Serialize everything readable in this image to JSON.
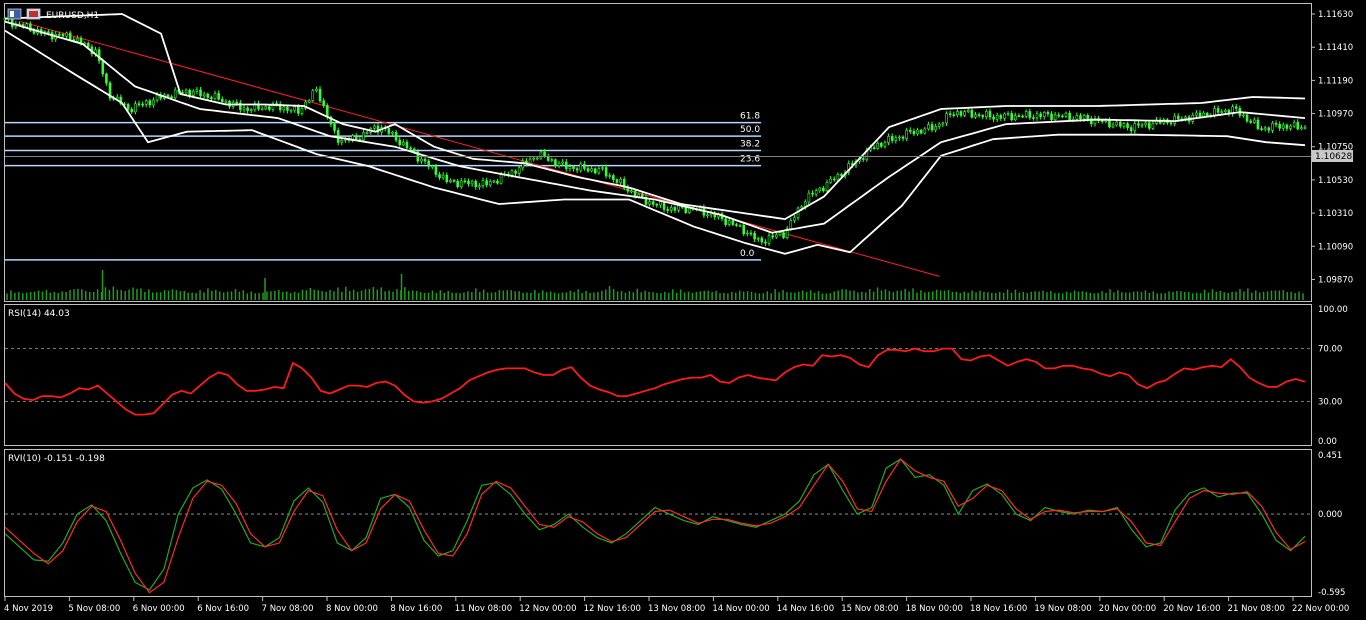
{
  "symbol_title": "EURUSD,H1",
  "colors": {
    "background": "#000000",
    "panel_border": "#c0c0c0",
    "candle": "#33ff33",
    "bands": "#ffffff",
    "fib": "#b4d7ff",
    "trend": "#ff2020",
    "volume": "#1f9d1f",
    "rsi": "#ff1a1a",
    "rvi_main": "#1faa1f",
    "rvi_signal": "#ff2a2a",
    "current_price_box": "#c8c8c8"
  },
  "current_price_label": "1.10628",
  "rsi_header": "RSI(14) 44.03",
  "rvi_header": "RVI(10) -0.151 -0.198",
  "chart_data": [
    {
      "type": "candlestick",
      "title": "EURUSD,H1",
      "price_ticks": [
        "1.11630",
        "1.11410",
        "1.11190",
        "1.10970",
        "1.10750",
        "1.10530",
        "1.10310",
        "1.10090",
        "1.09870"
      ],
      "ylim": [
        1.098,
        1.1167
      ],
      "current_price": 1.10628,
      "fibonacci_levels": [
        {
          "label": "61.8",
          "price": 1.1091
        },
        {
          "label": "50.0",
          "price": 1.1082
        },
        {
          "label": "38.2",
          "price": 1.10725
        },
        {
          "label": "23.6",
          "price": 1.10625
        },
        {
          "label": "0.0",
          "price": 1.1
        }
      ],
      "price_path_anchors": [
        [
          0,
          1.1159
        ],
        [
          0.03,
          1.115
        ],
        [
          0.05,
          1.1148
        ],
        [
          0.07,
          1.1138
        ],
        [
          0.08,
          1.111
        ],
        [
          0.095,
          1.11
        ],
        [
          0.12,
          1.1108
        ],
        [
          0.14,
          1.1112
        ],
        [
          0.16,
          1.1108
        ],
        [
          0.185,
          1.11
        ],
        [
          0.21,
          1.1102
        ],
        [
          0.225,
          1.1098
        ],
        [
          0.24,
          1.1113
        ],
        [
          0.255,
          1.108
        ],
        [
          0.27,
          1.108
        ],
        [
          0.28,
          1.1086
        ],
        [
          0.29,
          1.1088
        ],
        [
          0.31,
          1.1074
        ],
        [
          0.34,
          1.1052
        ],
        [
          0.37,
          1.105
        ],
        [
          0.39,
          1.1058
        ],
        [
          0.41,
          1.107
        ],
        [
          0.43,
          1.1062
        ],
        [
          0.46,
          1.1059
        ],
        [
          0.49,
          1.104
        ],
        [
          0.51,
          1.1034
        ],
        [
          0.53,
          1.1034
        ],
        [
          0.55,
          1.1028
        ],
        [
          0.57,
          1.1019
        ],
        [
          0.58,
          1.1012
        ],
        [
          0.6,
          1.1018
        ],
        [
          0.615,
          1.104
        ],
        [
          0.64,
          1.1055
        ],
        [
          0.67,
          1.1076
        ],
        [
          0.695,
          1.1084
        ],
        [
          0.715,
          1.1088
        ],
        [
          0.73,
          1.1098
        ],
        [
          0.76,
          1.1095
        ],
        [
          0.8,
          1.1096
        ],
        [
          0.83,
          1.1094
        ],
        [
          0.865,
          1.1088
        ],
        [
          0.88,
          1.109
        ],
        [
          0.92,
          1.1096
        ],
        [
          0.945,
          1.11
        ],
        [
          0.955,
          1.1094
        ],
        [
          0.965,
          1.1087
        ],
        [
          0.98,
          1.1089
        ],
        [
          1.0,
          1.1088
        ]
      ],
      "upper_band_anchors": [
        [
          0,
          1.116
        ],
        [
          0.09,
          1.1163
        ],
        [
          0.12,
          1.115
        ],
        [
          0.135,
          1.111
        ],
        [
          0.17,
          1.1103
        ],
        [
          0.2,
          1.1103
        ],
        [
          0.23,
          1.1102
        ],
        [
          0.26,
          1.109
        ],
        [
          0.285,
          1.1085
        ],
        [
          0.3,
          1.109
        ],
        [
          0.33,
          1.1075
        ],
        [
          0.36,
          1.1067
        ],
        [
          0.4,
          1.1064
        ],
        [
          0.44,
          1.1055
        ],
        [
          0.48,
          1.1048
        ],
        [
          0.52,
          1.1037
        ],
        [
          0.56,
          1.1032
        ],
        [
          0.6,
          1.1027
        ],
        [
          0.63,
          1.1042
        ],
        [
          0.68,
          1.1088
        ],
        [
          0.72,
          1.11
        ],
        [
          0.77,
          1.1102
        ],
        [
          0.84,
          1.1102
        ],
        [
          0.92,
          1.1104
        ],
        [
          0.96,
          1.1108
        ],
        [
          1.0,
          1.1107
        ]
      ],
      "middle_band_anchors": [
        [
          0,
          1.1158
        ],
        [
          0.06,
          1.1143
        ],
        [
          0.1,
          1.1115
        ],
        [
          0.15,
          1.11
        ],
        [
          0.21,
          1.1094
        ],
        [
          0.25,
          1.1082
        ],
        [
          0.3,
          1.1075
        ],
        [
          0.35,
          1.1062
        ],
        [
          0.4,
          1.1054
        ],
        [
          0.45,
          1.1046
        ],
        [
          0.5,
          1.104
        ],
        [
          0.55,
          1.103
        ],
        [
          0.59,
          1.1018
        ],
        [
          0.63,
          1.1024
        ],
        [
          0.68,
          1.1055
        ],
        [
          0.72,
          1.1078
        ],
        [
          0.77,
          1.109
        ],
        [
          0.84,
          1.1093
        ],
        [
          0.9,
          1.1092
        ],
        [
          0.95,
          1.1098
        ],
        [
          1.0,
          1.1094
        ]
      ],
      "lower_band_anchors": [
        [
          0,
          1.1152
        ],
        [
          0.05,
          1.1125
        ],
        [
          0.09,
          1.1104
        ],
        [
          0.11,
          1.1078
        ],
        [
          0.14,
          1.1085
        ],
        [
          0.19,
          1.1086
        ],
        [
          0.24,
          1.107
        ],
        [
          0.28,
          1.1062
        ],
        [
          0.33,
          1.1048
        ],
        [
          0.38,
          1.1037
        ],
        [
          0.43,
          1.104
        ],
        [
          0.48,
          1.104
        ],
        [
          0.53,
          1.1022
        ],
        [
          0.57,
          1.1011
        ],
        [
          0.6,
          1.1004
        ],
        [
          0.625,
          1.101
        ],
        [
          0.65,
          1.1005
        ],
        [
          0.69,
          1.1036
        ],
        [
          0.72,
          1.1069
        ],
        [
          0.76,
          1.108
        ],
        [
          0.81,
          1.1083
        ],
        [
          0.87,
          1.1083
        ],
        [
          0.94,
          1.1082
        ],
        [
          0.97,
          1.1078
        ],
        [
          1.0,
          1.1076
        ]
      ],
      "trendline": [
        [
          0.012,
          1.1158
        ],
        [
          0.565,
          1.0993
        ]
      ],
      "volume_profile": [
        0.3,
        0.35,
        0.45,
        0.55,
        0.4,
        0.35,
        0.4,
        0.3,
        0.35,
        0.45,
        0.5,
        0.5,
        0.35,
        0.3,
        0.4,
        0.35,
        0.3,
        0.35,
        0.4,
        0.3,
        0.35,
        0.3,
        0.3,
        0.35,
        0.3,
        0.4,
        0.45,
        0.4,
        0.35,
        0.3,
        0.35,
        0.3,
        0.3,
        0.35,
        0.3,
        0.3,
        0.35,
        0.4,
        0.35,
        0.3
      ]
    },
    {
      "type": "line",
      "title": "RSI(14) 44.03",
      "ticks": [
        "100.00",
        "70.00",
        "30.00",
        "0.00"
      ],
      "ylim": [
        0,
        100
      ],
      "levels": [
        70,
        30
      ],
      "series": [
        {
          "values": [
            44,
            36,
            32,
            31,
            34,
            34,
            33,
            36,
            40,
            39,
            42,
            36,
            30,
            24,
            20,
            20,
            21,
            28,
            35,
            38,
            36,
            42,
            48,
            52,
            50,
            43,
            38,
            38,
            39,
            41,
            40,
            59,
            55,
            48,
            38,
            36,
            39,
            42,
            42,
            41,
            44,
            45,
            42,
            35,
            30,
            29,
            30,
            32,
            36,
            40,
            46,
            49,
            52,
            54,
            55,
            55,
            55,
            52,
            50,
            50,
            54,
            56,
            48,
            42,
            39,
            37,
            34,
            34,
            36,
            38,
            40,
            43,
            45,
            47,
            48,
            48,
            50,
            45,
            44,
            48,
            50,
            48,
            47,
            46,
            52,
            56,
            58,
            57,
            65,
            64,
            65,
            63,
            58,
            56,
            65,
            69,
            69,
            68,
            70,
            68,
            68,
            70,
            70,
            62,
            61,
            64,
            65,
            61,
            57,
            60,
            62,
            60,
            55,
            55,
            57,
            57,
            55,
            54,
            51,
            49,
            52,
            50,
            43,
            40,
            44,
            46,
            51,
            55,
            54,
            56,
            57,
            56,
            62,
            56,
            48,
            44,
            41,
            41,
            45,
            47,
            45
          ]
        }
      ]
    },
    {
      "type": "line",
      "title": "RVI(10) -0.151 -0.198",
      "ticks": [
        "0.451",
        "0.000",
        "-0.595"
      ],
      "ylim": [
        -0.595,
        0.451
      ],
      "levels": [
        0
      ],
      "series": [
        {
          "values": [
            -0.15,
            -0.25,
            -0.35,
            -0.36,
            -0.22,
            0.0,
            0.07,
            -0.05,
            -0.3,
            -0.52,
            -0.58,
            -0.42,
            0.0,
            0.2,
            0.26,
            0.19,
            0.0,
            -0.22,
            -0.25,
            -0.18,
            0.1,
            0.2,
            0.09,
            -0.22,
            -0.28,
            -0.18,
            0.12,
            0.15,
            0.05,
            -0.2,
            -0.32,
            -0.28,
            -0.05,
            0.22,
            0.24,
            0.15,
            0.0,
            -0.12,
            -0.08,
            0.0,
            -0.1,
            -0.18,
            -0.22,
            -0.15,
            -0.05,
            0.05,
            0.0,
            -0.05,
            -0.08,
            -0.02,
            -0.05,
            -0.08,
            -0.1,
            -0.05,
            0.0,
            0.1,
            0.3,
            0.38,
            0.18,
            0.0,
            0.05,
            0.35,
            0.42,
            0.28,
            0.3,
            0.22,
            0.0,
            0.18,
            0.23,
            0.15,
            0.0,
            -0.05,
            0.05,
            0.02,
            0.0,
            0.03,
            0.02,
            0.05,
            -0.12,
            -0.25,
            -0.22,
            0.03,
            0.16,
            0.2,
            0.13,
            0.16,
            0.16,
            0.0,
            -0.2,
            -0.28,
            -0.17
          ]
        },
        {
          "values": [
            -0.1,
            -0.2,
            -0.3,
            -0.38,
            -0.28,
            -0.06,
            0.06,
            0.02,
            -0.2,
            -0.45,
            -0.6,
            -0.52,
            -0.18,
            0.12,
            0.25,
            0.22,
            0.08,
            -0.15,
            -0.25,
            -0.22,
            0.02,
            0.18,
            0.14,
            -0.12,
            -0.28,
            -0.22,
            0.04,
            0.15,
            0.1,
            -0.12,
            -0.3,
            -0.32,
            -0.15,
            0.15,
            0.25,
            0.2,
            0.06,
            -0.08,
            -0.1,
            -0.02,
            -0.06,
            -0.15,
            -0.21,
            -0.18,
            -0.08,
            0.02,
            0.03,
            -0.02,
            -0.07,
            -0.04,
            -0.04,
            -0.07,
            -0.09,
            -0.07,
            -0.02,
            0.05,
            0.22,
            0.38,
            0.25,
            0.04,
            0.02,
            0.25,
            0.42,
            0.33,
            0.28,
            0.25,
            0.06,
            0.12,
            0.22,
            0.18,
            0.04,
            -0.04,
            0.02,
            0.03,
            0.01,
            0.02,
            0.02,
            0.04,
            -0.06,
            -0.22,
            -0.24,
            -0.06,
            0.12,
            0.18,
            0.16,
            0.15,
            0.17,
            0.06,
            -0.14,
            -0.27,
            -0.21
          ]
        }
      ]
    }
  ],
  "time_labels": [
    "4 Nov 2019",
    "5 Nov 08:00",
    "6 Nov 00:00",
    "6 Nov 16:00",
    "7 Nov 08:00",
    "8 Nov 00:00",
    "8 Nov 16:00",
    "11 Nov 08:00",
    "12 Nov 00:00",
    "12 Nov 16:00",
    "13 Nov 08:00",
    "14 Nov 00:00",
    "14 Nov 16:00",
    "15 Nov 08:00",
    "18 Nov 00:00",
    "18 Nov 16:00",
    "19 Nov 08:00",
    "20 Nov 00:00",
    "20 Nov 16:00",
    "21 Nov 08:00",
    "22 Nov 00:00"
  ]
}
